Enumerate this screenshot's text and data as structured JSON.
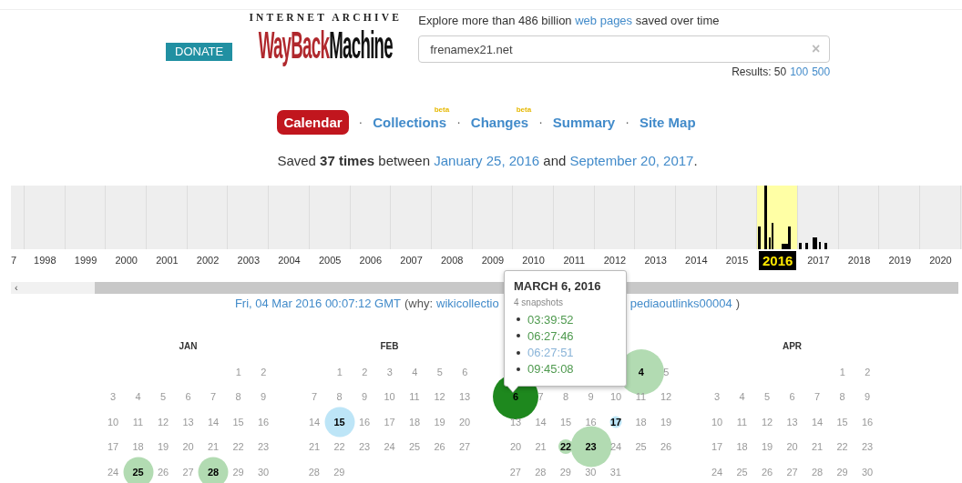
{
  "header": {
    "donate": "DONATE",
    "logo": {
      "top": "INTERNET ARCHIVE",
      "first": "WayBack",
      "second": "Machine"
    },
    "tagline": {
      "before": "Explore more than 486 billion",
      "link": "web pages",
      "after": "saved over time"
    },
    "search": {
      "value": "frenamex21.net",
      "clear": "×"
    },
    "results": {
      "label": "Results: 50",
      "links": [
        "100",
        "500"
      ]
    }
  },
  "nav": [
    {
      "label": "Calendar",
      "selected": true
    },
    {
      "label": "Collections",
      "selected": false,
      "badge": "beta",
      "separator": "·"
    },
    {
      "label": "Changes",
      "selected": false,
      "badge": "beta",
      "separator": "·"
    },
    {
      "label": "Summary",
      "selected": false,
      "separator": "·"
    },
    {
      "label": "Site Map",
      "selected": false,
      "separator": "·"
    }
  ],
  "saved": {
    "before": "Saved **37 times** between",
    "first": "January 25, 2016",
    "middle": "and",
    "last": "September 20, 2017",
    "end": "."
  },
  "timeline": {
    "years": [
      {
        "label": "7",
        "selected": false
      },
      {
        "label": "1998",
        "selected": false
      },
      {
        "label": "1999",
        "selected": false
      },
      {
        "label": "2000",
        "selected": false
      },
      {
        "label": "2001",
        "selected": false
      },
      {
        "label": "2002",
        "selected": false
      },
      {
        "label": "2003",
        "selected": false
      },
      {
        "label": "2004",
        "selected": false
      },
      {
        "label": "2005",
        "selected": false
      },
      {
        "label": "2006",
        "selected": false
      },
      {
        "label": "2007",
        "selected": false
      },
      {
        "label": "2008",
        "selected": false
      },
      {
        "label": "2009",
        "selected": false
      },
      {
        "label": "2010",
        "selected": false
      },
      {
        "label": "2011",
        "selected": false
      },
      {
        "label": "2012",
        "selected": false
      },
      {
        "label": "2013",
        "selected": false
      },
      {
        "label": "2014",
        "selected": false
      },
      {
        "label": "2015",
        "selected": false
      },
      {
        "label": "2016",
        "selected": true
      },
      {
        "label": "2017",
        "selected": false
      },
      {
        "label": "2018",
        "selected": false
      },
      {
        "label": "2019",
        "selected": false
      },
      {
        "label": "2020",
        "selected": false
      }
    ],
    "scroll_left": "‹"
  },
  "capture": {
    "time": "Fri, 04 Mar 2016 00:07:12 GMT",
    "why": "(why:",
    "links": [
      "wikicollectio",
      "pediaoutlinks00004"
    ],
    "end": ")"
  },
  "months": [
    {
      "name": "JAN",
      "weeks": [
        {
          "kind": "first",
          "days": [
            {
              "d": "1",
              "kind": "day"
            },
            {
              "d": "2",
              "kind": "day"
            }
          ]
        },
        {
          "kind": "full",
          "days": [
            {
              "d": "3",
              "kind": "day"
            },
            {
              "d": "4",
              "kind": "day"
            },
            {
              "d": "5",
              "kind": "day"
            },
            {
              "d": "6",
              "kind": "day"
            },
            {
              "d": "7",
              "kind": "day"
            },
            {
              "d": "8",
              "kind": "day"
            },
            {
              "d": "9",
              "kind": "day"
            }
          ]
        },
        {
          "kind": "full",
          "days": [
            {
              "d": "10",
              "kind": "day"
            },
            {
              "d": "11",
              "kind": "day"
            },
            {
              "d": "12",
              "kind": "day"
            },
            {
              "d": "13",
              "kind": "day"
            },
            {
              "d": "14",
              "kind": "day"
            },
            {
              "d": "15",
              "kind": "day"
            },
            {
              "d": "16",
              "kind": "day"
            }
          ]
        },
        {
          "kind": "full",
          "days": [
            {
              "d": "17",
              "kind": "day"
            },
            {
              "d": "18",
              "kind": "day"
            },
            {
              "d": "19",
              "kind": "day"
            },
            {
              "d": "20",
              "kind": "day"
            },
            {
              "d": "21",
              "kind": "day"
            },
            {
              "d": "22",
              "kind": "day"
            },
            {
              "d": "23",
              "kind": "day"
            }
          ]
        },
        {
          "kind": "full",
          "days": [
            {
              "d": "24",
              "kind": "day"
            },
            {
              "d": "25",
              "kind": "medium",
              "color": "#b2dbb2"
            },
            {
              "d": "26",
              "kind": "day"
            },
            {
              "d": "27",
              "kind": "day"
            },
            {
              "d": "28",
              "kind": "medium",
              "color": "#b2dbb2"
            },
            {
              "d": "29",
              "kind": "day"
            },
            {
              "d": "30",
              "kind": "day"
            }
          ]
        }
      ]
    },
    {
      "name": "FEB",
      "weeks": [
        {
          "kind": "first",
          "days": [
            {
              "d": "1",
              "kind": "day"
            },
            {
              "d": "2",
              "kind": "day"
            },
            {
              "d": "3",
              "kind": "day"
            },
            {
              "d": "4",
              "kind": "day"
            },
            {
              "d": "5",
              "kind": "day"
            },
            {
              "d": "6",
              "kind": "day"
            }
          ]
        },
        {
          "kind": "full",
          "days": [
            {
              "d": "7",
              "kind": "day"
            },
            {
              "d": "8",
              "kind": "day"
            },
            {
              "d": "9",
              "kind": "day"
            },
            {
              "d": "10",
              "kind": "day"
            },
            {
              "d": "11",
              "kind": "day"
            },
            {
              "d": "12",
              "kind": "day"
            },
            {
              "d": "13",
              "kind": "day"
            }
          ]
        },
        {
          "kind": "full",
          "days": [
            {
              "d": "14",
              "kind": "day"
            },
            {
              "d": "15",
              "kind": "medium",
              "color": "#bde5f7"
            },
            {
              "d": "16",
              "kind": "day"
            },
            {
              "d": "17",
              "kind": "day"
            },
            {
              "d": "18",
              "kind": "day"
            },
            {
              "d": "19",
              "kind": "day"
            },
            {
              "d": "20",
              "kind": "day"
            }
          ]
        },
        {
          "kind": "full",
          "days": [
            {
              "d": "21",
              "kind": "day"
            },
            {
              "d": "22",
              "kind": "day"
            },
            {
              "d": "23",
              "kind": "day"
            },
            {
              "d": "24",
              "kind": "day"
            },
            {
              "d": "25",
              "kind": "day"
            },
            {
              "d": "26",
              "kind": "day"
            },
            {
              "d": "27",
              "kind": "day"
            }
          ]
        },
        {
          "kind": "last",
          "days": [
            {
              "d": "28",
              "kind": "day"
            },
            {
              "d": "29",
              "kind": "day"
            }
          ]
        }
      ]
    },
    {
      "weeks": [
        {
          "kind": "first",
          "days": [
            {
              "d": "4",
              "kind": "huge",
              "color": "#b2dbb2"
            },
            {
              "d": "5",
              "kind": "day"
            }
          ]
        },
        {
          "kind": "full",
          "days": [
            {
              "d": "6",
              "kind": "huge",
              "color": "#1e881e"
            },
            {
              "d": "7",
              "kind": "day"
            },
            {
              "d": "8",
              "kind": "day"
            },
            {
              "d": "9",
              "kind": "day"
            },
            {
              "d": "10",
              "kind": "day"
            },
            {
              "d": "11",
              "kind": "day"
            },
            {
              "d": "12",
              "kind": "day"
            }
          ]
        },
        {
          "kind": "full",
          "days": [
            {
              "d": "13",
              "kind": "day"
            },
            {
              "d": "14",
              "kind": "day"
            },
            {
              "d": "15",
              "kind": "day"
            },
            {
              "d": "16",
              "kind": "day"
            },
            {
              "d": "17",
              "kind": "dot",
              "color": "#bde5f7"
            },
            {
              "d": "18",
              "kind": "day"
            },
            {
              "d": "19",
              "kind": "day"
            }
          ]
        },
        {
          "kind": "full",
          "days": [
            {
              "d": "20",
              "kind": "day"
            },
            {
              "d": "21",
              "kind": "day"
            },
            {
              "d": "22",
              "kind": "small",
              "color": "#b2dbb2"
            },
            {
              "d": "23",
              "kind": "large",
              "color": "#b2dbb2"
            },
            {
              "d": "24",
              "kind": "day"
            },
            {
              "d": "25",
              "kind": "day"
            },
            {
              "d": "26",
              "kind": "day"
            }
          ]
        },
        {
          "kind": "last",
          "days": [
            {
              "d": "27",
              "kind": "day"
            },
            {
              "d": "28",
              "kind": "day"
            },
            {
              "d": "29",
              "kind": "day"
            },
            {
              "d": "30",
              "kind": "day"
            },
            {
              "d": "31",
              "kind": "day"
            }
          ]
        }
      ]
    },
    {
      "name": "APR",
      "weeks": [
        {
          "kind": "first",
          "days": [
            {
              "d": "1",
              "kind": "day"
            },
            {
              "d": "2",
              "kind": "day"
            }
          ]
        },
        {
          "kind": "full",
          "days": [
            {
              "d": "3",
              "kind": "day"
            },
            {
              "d": "4",
              "kind": "day"
            },
            {
              "d": "5",
              "kind": "day"
            },
            {
              "d": "6",
              "kind": "day"
            },
            {
              "d": "7",
              "kind": "day"
            },
            {
              "d": "8",
              "kind": "day"
            },
            {
              "d": "9",
              "kind": "day"
            }
          ]
        },
        {
          "kind": "full",
          "days": [
            {
              "d": "10",
              "kind": "day"
            },
            {
              "d": "11",
              "kind": "day"
            },
            {
              "d": "12",
              "kind": "day"
            },
            {
              "d": "13",
              "kind": "day"
            },
            {
              "d": "14",
              "kind": "day"
            },
            {
              "d": "15",
              "kind": "day"
            },
            {
              "d": "16",
              "kind": "day"
            }
          ]
        },
        {
          "kind": "full",
          "days": [
            {
              "d": "17",
              "kind": "day"
            },
            {
              "d": "18",
              "kind": "day"
            },
            {
              "d": "19",
              "kind": "day"
            },
            {
              "d": "20",
              "kind": "day"
            },
            {
              "d": "21",
              "kind": "day"
            },
            {
              "d": "22",
              "kind": "day"
            },
            {
              "d": "23",
              "kind": "day"
            }
          ]
        },
        {
          "kind": "full",
          "days": [
            {
              "d": "24",
              "kind": "day"
            },
            {
              "d": "25",
              "kind": "day"
            },
            {
              "d": "26",
              "kind": "day"
            },
            {
              "d": "27",
              "kind": "day"
            },
            {
              "d": "28",
              "kind": "day"
            },
            {
              "d": "29",
              "kind": "day"
            },
            {
              "d": "30",
              "kind": "day"
            }
          ]
        }
      ]
    }
  ],
  "tooltip": {
    "title": "MARCH 6, 2016",
    "count": "4 snapshots",
    "times": [
      {
        "time": "03:39:52",
        "color": "#4f9a4f"
      },
      {
        "time": "06:27:46",
        "color": "#4f9a4f"
      },
      {
        "time": "06:27:51",
        "color": "#8ab4d8"
      },
      {
        "time": "09:45:08",
        "color": "#4f9a4f"
      }
    ]
  }
}
